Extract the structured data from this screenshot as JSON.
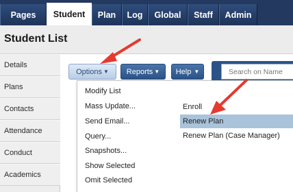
{
  "top_tabs": [
    "Pages",
    "Student",
    "Plan",
    "Log",
    "Global",
    "Staff",
    "Admin"
  ],
  "active_tab_index": 1,
  "page_title": "Student List",
  "sidebar": [
    "Details",
    "Plans",
    "Contacts",
    "Attendance",
    "Conduct",
    "Academics"
  ],
  "toolbar": {
    "options_label": "Options",
    "reports_label": "Reports",
    "help_label": "Help",
    "search_placeholder": "Search on Name"
  },
  "options_menu": [
    "Modify List",
    "Mass Update...",
    "Send Email...",
    "Query...",
    "Snapshots...",
    "Show Selected",
    "Omit Selected"
  ],
  "submenu": [
    "Enroll",
    "Renew Plan",
    "Renew Plan (Case Manager)"
  ],
  "highlighted_submenu_index": 1,
  "annotation_color": "#e53a2f",
  "colors": {
    "nav_bg": "#23395f",
    "button_bg": "#2c5388",
    "highlight": "#a9c3da"
  }
}
